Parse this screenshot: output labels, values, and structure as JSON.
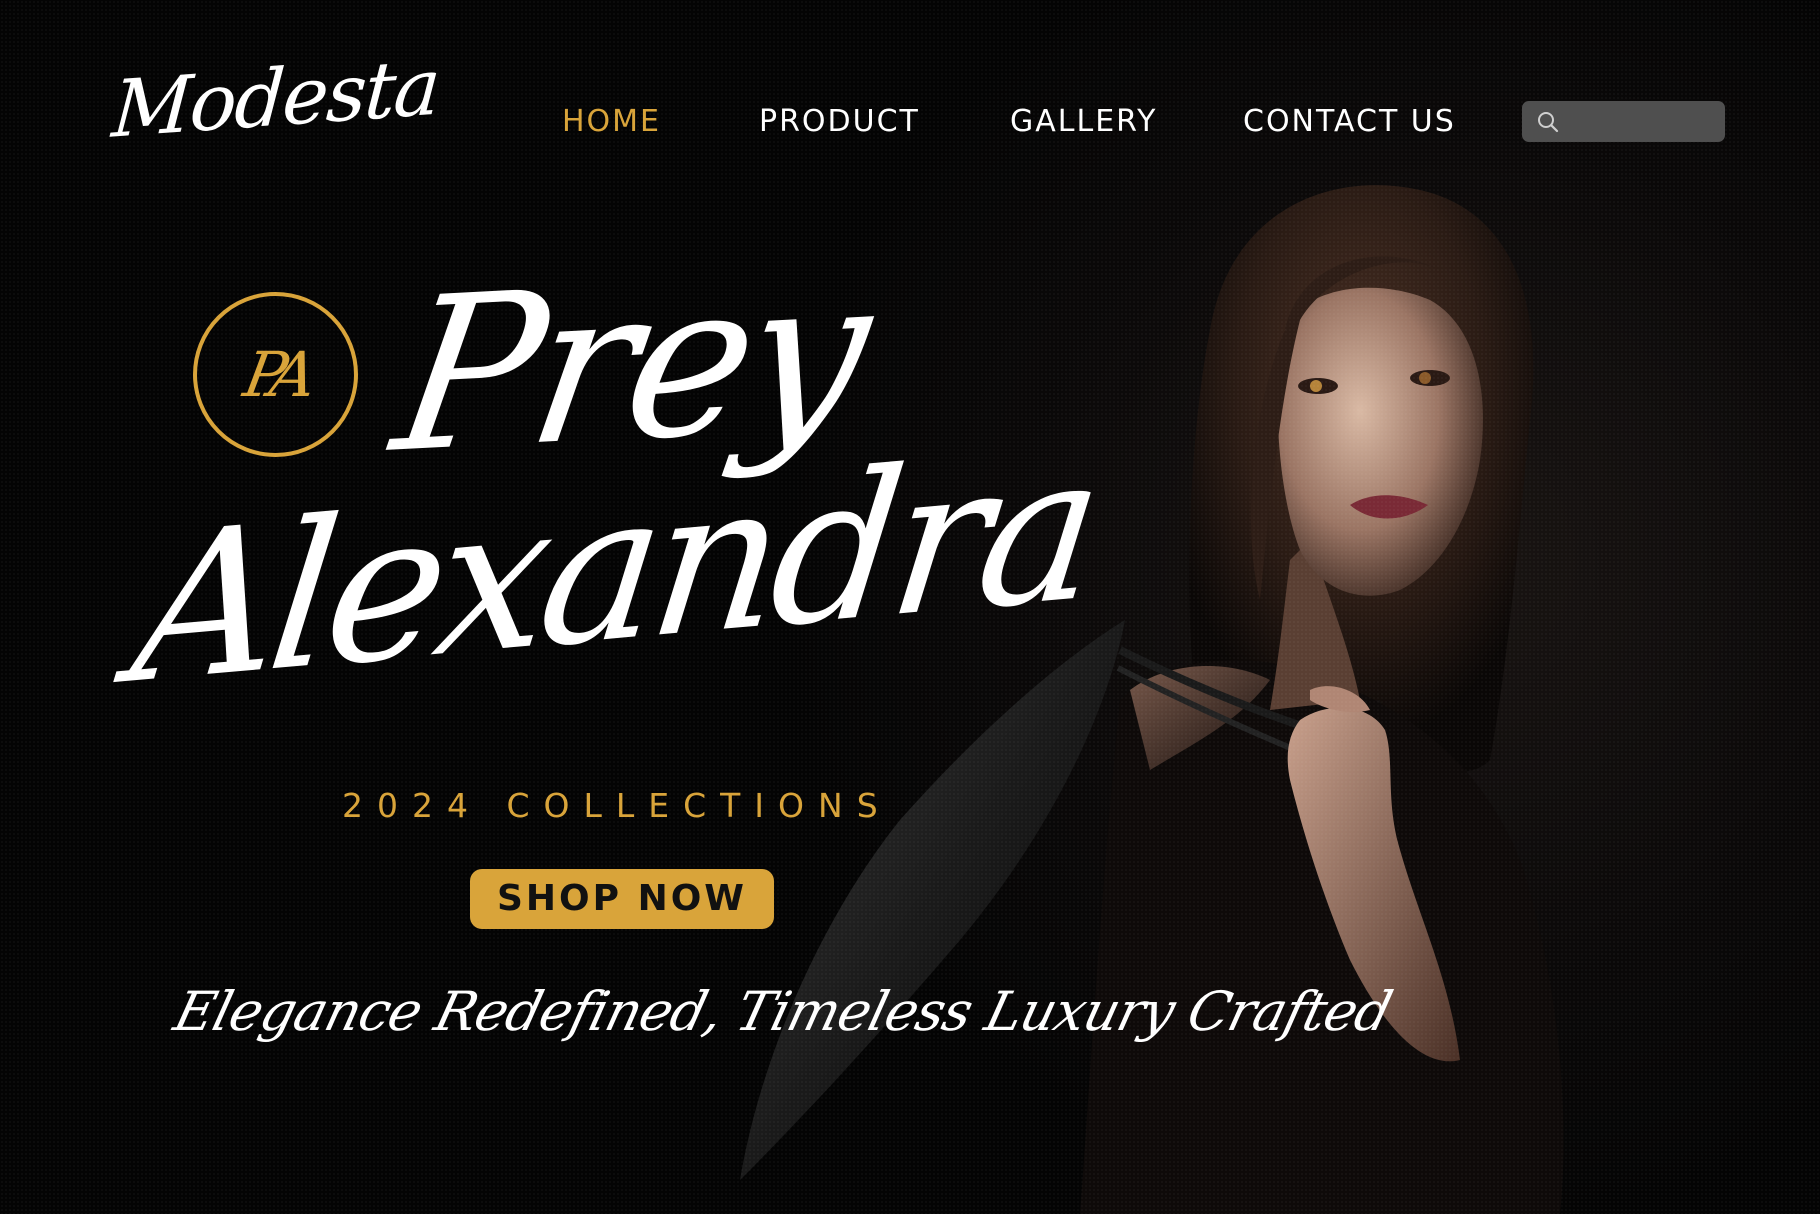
{
  "brand": {
    "logo_text": "Modesta"
  },
  "nav": {
    "items": [
      {
        "label": "HOME",
        "active": true
      },
      {
        "label": "PRODUCT",
        "active": false
      },
      {
        "label": "GALLERY",
        "active": false
      },
      {
        "label": "CONTACT US",
        "active": false
      }
    ],
    "search": {
      "icon": "search-icon",
      "placeholder": ""
    }
  },
  "hero": {
    "monogram": "PA",
    "title_line1": "Prey",
    "title_line2": "Alexandra",
    "collections": "2024 COLLECTIONS",
    "cta_label": "SHOP NOW",
    "tagline": "Elegance Redefined, Timeless Luxury Crafted"
  },
  "colors": {
    "background": "#050505",
    "accent": "#d9a43a",
    "text": "#ffffff",
    "search_bg": "#4f4f4f"
  }
}
